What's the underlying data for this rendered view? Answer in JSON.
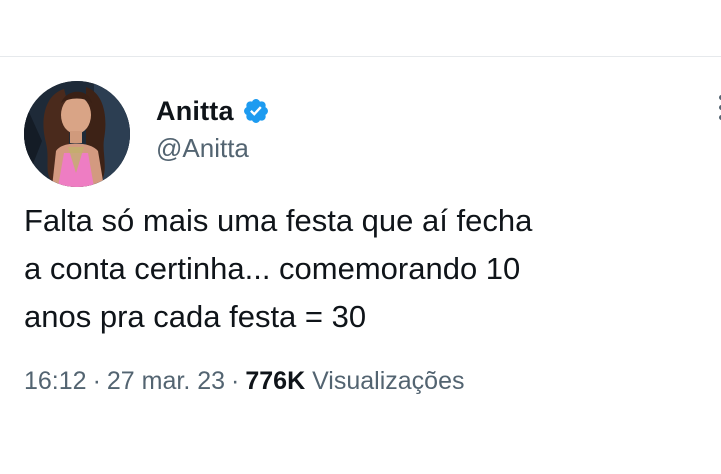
{
  "tweet": {
    "author": {
      "display_name": "Anitta",
      "handle": "@Anitta",
      "verified": true,
      "verified_icon": "verified-badge-icon",
      "verified_color": "#1d9bf0"
    },
    "text": "Falta só mais uma festa que aí fecha\na conta certinha... comemorando 10\nanos pra cada festa = 30",
    "time": "16:12",
    "separator": "·",
    "date": "27 mar. 23",
    "views_count": "776K",
    "views_label": "Visualizações"
  },
  "colors": {
    "text_primary": "#0f1419",
    "text_secondary": "#536471",
    "divider": "#e6e9ec"
  }
}
